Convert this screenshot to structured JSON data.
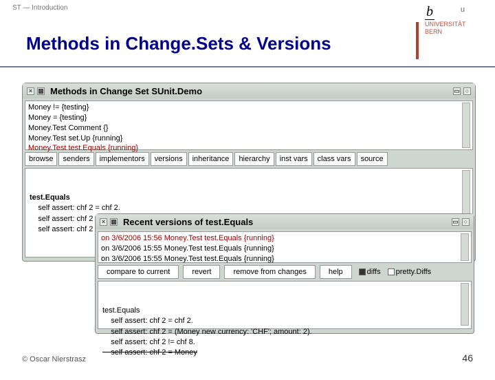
{
  "header": {
    "breadcrumb": "ST — Introduction",
    "title": "Methods in Change.Sets & Versions"
  },
  "logo": {
    "small_u": "u",
    "big_b": "b",
    "uni1": "UNIVERSITÄT",
    "uni2": "BERN"
  },
  "win1": {
    "title": "Methods in Change Set SUnit.Demo",
    "list": [
      "Money != {testing}",
      "Money = {testing}",
      "Money.Test Comment {}",
      "Money.Test set.Up {running}",
      "Money.Test test.Equals {running}"
    ],
    "list_selected_index": 4,
    "buttons": [
      "browse",
      "senders",
      "implementors",
      "versions",
      "inheritance",
      "hierarchy",
      "inst vars",
      "class vars",
      "source"
    ],
    "code_head": "test.Equals",
    "code_lines": [
      "    self assert: chf 2 = chf 2.",
      "    self assert: chf 2 = (Money new currency: 'CHF'; amount: 2).",
      "    self assert: chf 2 != chf 8."
    ]
  },
  "win2": {
    "title": "Recent versions of test.Equals",
    "list": [
      "on 3/6/2006 15:56 Money.Test test.Equals {running}",
      "on 3/6/2006 15:55 Money.Test test.Equals {running}",
      "on 3/6/2006 15:55 Money.Test test.Equals {running}"
    ],
    "list_selected_index": 0,
    "buttons": [
      "compare to current",
      "revert",
      "remove from changes",
      "help"
    ],
    "opts": [
      {
        "label": "diffs",
        "on": true
      },
      {
        "label": "pretty.Diffs",
        "on": false
      }
    ],
    "code_head": "test.Equals",
    "code_lines": [
      "    self assert: chf 2 = chf 2.",
      "    self assert: chf 2 = (Money new currency: 'CHF'; amount: 2).",
      "    self assert: chf 2 != chf 8."
    ],
    "code_strike": "    self assert: chf 2 = Money"
  },
  "footer": {
    "left": "© Oscar Nierstrasz",
    "right": "46"
  }
}
